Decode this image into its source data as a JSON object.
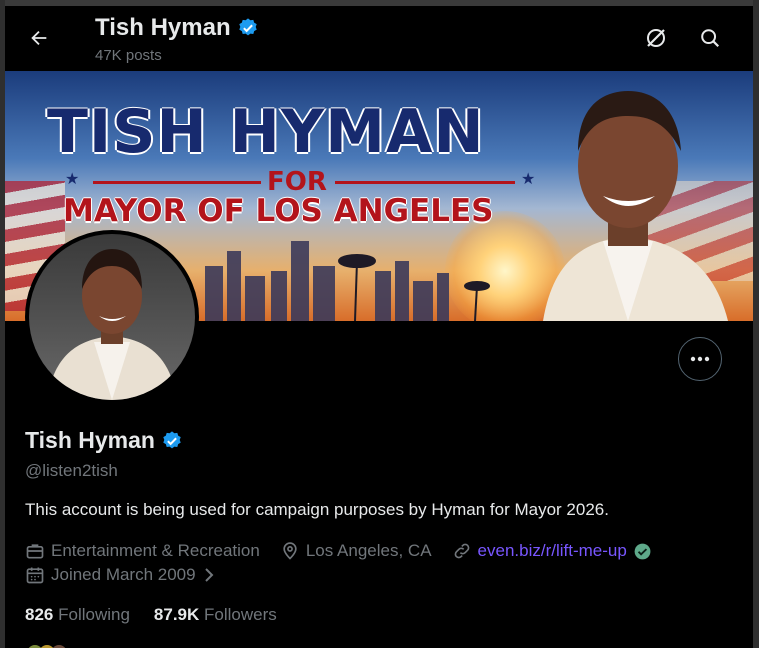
{
  "header": {
    "title": "Tish Hyman",
    "posts": "47K posts"
  },
  "banner": {
    "line1": "TISH HYMAN",
    "line2": "FOR",
    "line3": "MAYOR OF LOS ANGELES"
  },
  "profile": {
    "name": "Tish Hyman",
    "handle": "@listen2tish",
    "bio": "This account is being used for campaign purposes by Hyman for Mayor 2026.",
    "category": "Entertainment & Recreation",
    "location": "Los Angeles, CA",
    "website": "even.biz/r/lift-me-up",
    "joined": "Joined March 2009",
    "following_count": "826",
    "following_label": "Following",
    "followers_count": "87.9K",
    "followers_label": "Followers"
  },
  "colors": {
    "background": "#000000",
    "text": "#e7e9ea",
    "muted": "#71767b",
    "verified": "#1d9bf0",
    "link": "#7856ff",
    "link_verified": "#5ea98a"
  },
  "icons": [
    "back-arrow-icon",
    "verified-badge-icon",
    "grok-icon",
    "search-icon",
    "more-icon",
    "briefcase-icon",
    "location-pin-icon",
    "link-icon",
    "calendar-icon",
    "chevron-right-icon"
  ]
}
